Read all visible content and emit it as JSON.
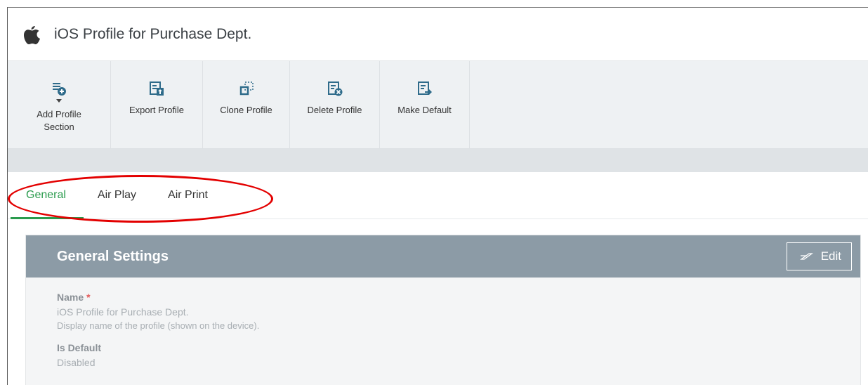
{
  "page": {
    "title": "iOS Profile for Purchase Dept.",
    "icon": "apple-icon"
  },
  "toolbar": {
    "items": [
      {
        "label": "Add Profile Section",
        "icon": "add-list-icon",
        "has_dropdown": true
      },
      {
        "label": "Export Profile",
        "icon": "export-icon"
      },
      {
        "label": "Clone Profile",
        "icon": "clone-icon"
      },
      {
        "label": "Delete Profile",
        "icon": "delete-icon"
      },
      {
        "label": "Make Default",
        "icon": "make-default-icon"
      }
    ]
  },
  "tabs": {
    "items": [
      {
        "label": "General",
        "active": true
      },
      {
        "label": "Air Play",
        "active": false
      },
      {
        "label": "Air Print",
        "active": false
      }
    ],
    "annotation_color": "#e30000"
  },
  "panel": {
    "title": "General Settings",
    "edit_label": "Edit",
    "fields": {
      "name_label": "Name",
      "required_mark": "*",
      "name_value": "iOS Profile for Purchase Dept.",
      "name_help": "Display name of the profile (shown on the device).",
      "default_label": "Is Default",
      "default_value": "Disabled"
    }
  },
  "colors": {
    "accent": "#2a9b4d",
    "header_bg": "#8c9ba6",
    "toolbar_bg": "#eef1f3",
    "toolbar_icon": "#2e6b8a"
  }
}
